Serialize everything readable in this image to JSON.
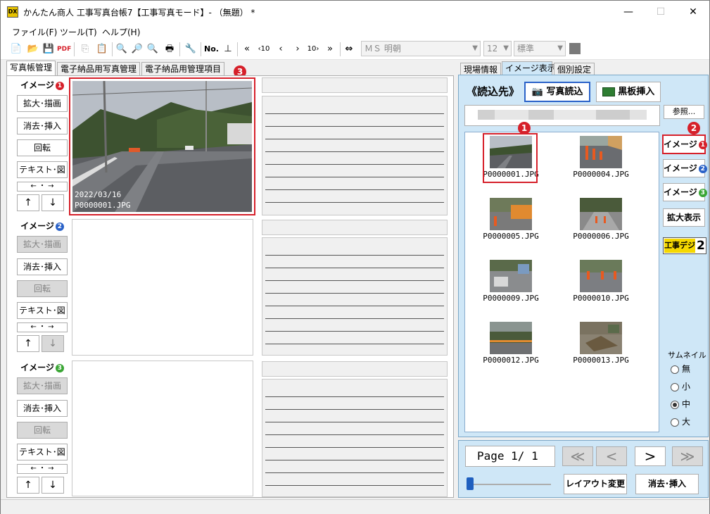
{
  "window": {
    "title": "かんたん商人 工事写真台帳7【工事写真モード】- （無題） *",
    "minimize": "—",
    "maximize": "☐",
    "close": "✕"
  },
  "menu": {
    "items": [
      {
        "label": "ファイル(F)"
      },
      {
        "label": "ツール(T)"
      },
      {
        "label": "ヘルプ(H)"
      }
    ]
  },
  "toolbar": {
    "font_name": "ＭＳ 明朝",
    "font_size": "12",
    "font_style": "標準",
    "no_label": "No."
  },
  "left_tabs": [
    {
      "label": "写真帳管理"
    },
    {
      "label": "電子納品用写真管理"
    },
    {
      "label": "電子納品用管理項目"
    }
  ],
  "image_groups": [
    {
      "label": "イメージ",
      "badge": "1"
    },
    {
      "label": "イメージ",
      "badge": "2"
    },
    {
      "label": "イメージ",
      "badge": "3"
    }
  ],
  "left_buttons": {
    "expand_draw": "拡大･描画",
    "erase_insert": "消去･挿入",
    "rotate": "回転",
    "text_figure": "テキスト･図",
    "lr_arrows": "← ・ →",
    "up": "↑",
    "down": "↓"
  },
  "photo1": {
    "date": "2022/03/16",
    "filename": "P0000001.JPG"
  },
  "callouts": {
    "c1": "1",
    "c2": "2",
    "c3": "3"
  },
  "right_tabs": [
    {
      "label": "現場情報"
    },
    {
      "label": "イメージ表示"
    },
    {
      "label": "個別設定"
    }
  ],
  "right_panel": {
    "source_label": "《読込先》",
    "load_photo": "写真読込",
    "insert_board": "黒板挿入",
    "browse": "参照..."
  },
  "thumbnails": [
    {
      "name": "P0000001.JPG"
    },
    {
      "name": "P0000004.JPG"
    },
    {
      "name": "P0000005.JPG"
    },
    {
      "name": "P0000006.JPG"
    },
    {
      "name": "P0000009.JPG"
    },
    {
      "name": "P0000010.JPG"
    },
    {
      "name": "P0000012.JPG"
    },
    {
      "name": "P0000013.JPG"
    }
  ],
  "side_buttons": {
    "image1": "イメージ",
    "image2": "イメージ",
    "image3": "イメージ",
    "enlarge": "拡大表示",
    "kouji_digi": "工事デジ",
    "kouji_digi_num": "2"
  },
  "thumbnail_size": {
    "label": "サムネイル",
    "options": [
      "無",
      "小",
      "中",
      "大"
    ],
    "selected": "中"
  },
  "paging": {
    "page_text": "Page  1/ 1",
    "first": "≪",
    "prev": "<",
    "next": ">",
    "last": "≫",
    "layout_change": "レイアウト変更",
    "erase_insert": "消去･挿入"
  }
}
